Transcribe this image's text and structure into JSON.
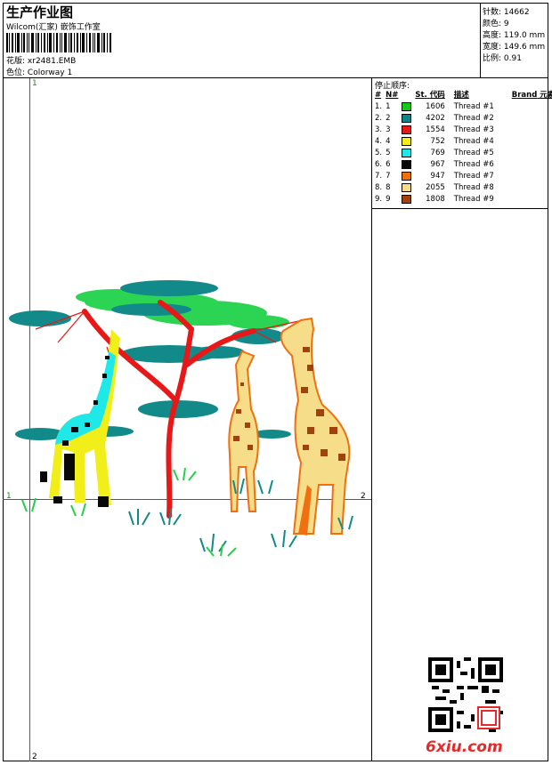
{
  "header": {
    "title": "生产作业图",
    "company": "Wilcom(汇家) 嵌饰工作室",
    "design_label": "花版:",
    "design_value": "xr2481.EMB",
    "colorway_label": "色位:",
    "colorway_value": "Colorway 1"
  },
  "stats": [
    {
      "label": "针数:",
      "value": "14662"
    },
    {
      "label": "颜色:",
      "value": "9"
    },
    {
      "label": "高度:",
      "value": "119.0 mm"
    },
    {
      "label": "宽度:",
      "value": "149.6 mm"
    },
    {
      "label": "比例:",
      "value": "0.91"
    }
  ],
  "stop_sequence": {
    "title": "停止顺序:",
    "headers": {
      "seq": "#",
      "no": "N#",
      "st": "St.",
      "code": "代码",
      "desc": "描述",
      "brand": "Brand",
      "element": "元素"
    },
    "rows": [
      {
        "seq": "1.",
        "no": "1",
        "color": "#18c818",
        "code": "1606",
        "desc": "Thread #1"
      },
      {
        "seq": "2.",
        "no": "2",
        "color": "#0f8585",
        "code": "4202",
        "desc": "Thread #2"
      },
      {
        "seq": "3.",
        "no": "3",
        "color": "#e81818",
        "code": "1554",
        "desc": "Thread #3"
      },
      {
        "seq": "4.",
        "no": "4",
        "color": "#f2ee1a",
        "code": "752",
        "desc": "Thread #4"
      },
      {
        "seq": "5.",
        "no": "5",
        "color": "#1fe8e8",
        "code": "769",
        "desc": "Thread #5"
      },
      {
        "seq": "6.",
        "no": "6",
        "color": "#080808",
        "code": "967",
        "desc": "Thread #6"
      },
      {
        "seq": "7.",
        "no": "7",
        "color": "#f07010",
        "code": "947",
        "desc": "Thread #7"
      },
      {
        "seq": "8.",
        "no": "8",
        "color": "#f6dd8a",
        "code": "2055",
        "desc": "Thread #8"
      },
      {
        "seq": "9.",
        "no": "9",
        "color": "#a0420e",
        "code": "1808",
        "desc": "Thread #9"
      }
    ]
  },
  "guides": {
    "top": "1",
    "left": "1",
    "right": "2",
    "bottom": "2"
  },
  "watermark": {
    "logo": "6xiu.com"
  }
}
